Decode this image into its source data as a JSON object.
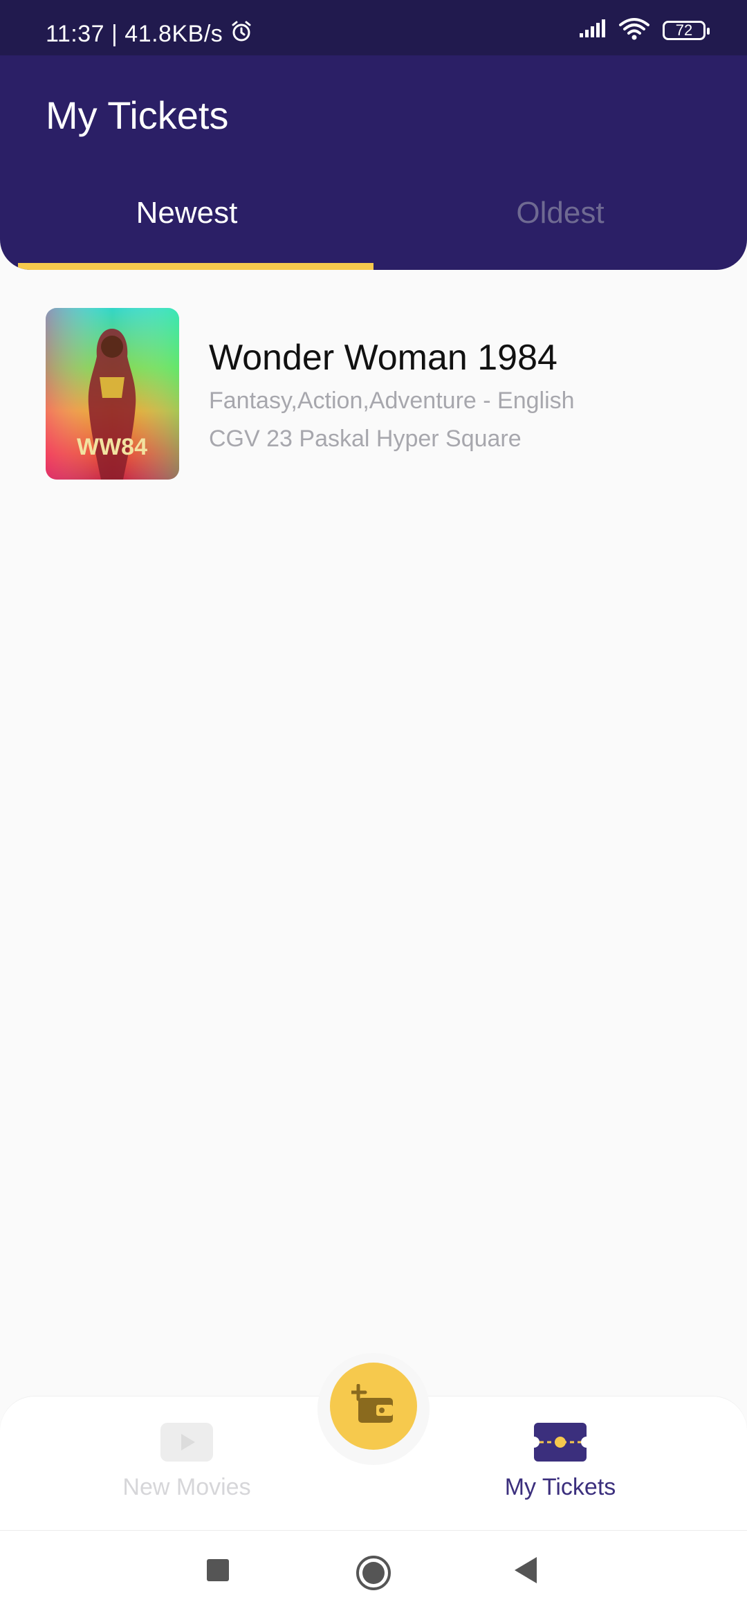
{
  "status_bar": {
    "time_speed": "11:37 | 41.8KB/s",
    "battery": "72",
    "icons": [
      "alarm-icon",
      "signal-icon",
      "wifi-icon",
      "battery-icon"
    ]
  },
  "header": {
    "title": "My Tickets",
    "tabs": [
      {
        "label": "Newest",
        "active": true
      },
      {
        "label": "Oldest",
        "active": false
      }
    ]
  },
  "tickets": [
    {
      "title": "Wonder Woman 1984",
      "genre": "Fantasy,Action,Adventure - English",
      "cinema": "CGV 23 Paskal Hyper Square",
      "poster_text": "WW84"
    }
  ],
  "bottom_nav": {
    "items": [
      {
        "label": "New Movies",
        "icon": "play-icon",
        "active": false
      },
      {
        "label": "My Tickets",
        "icon": "ticket-icon",
        "active": true
      }
    ],
    "fab_icon": "add-wallet-icon"
  },
  "colors": {
    "header_bg": "#2b1f66",
    "accent": "#f6c94d",
    "active_nav": "#3b2f7d"
  }
}
